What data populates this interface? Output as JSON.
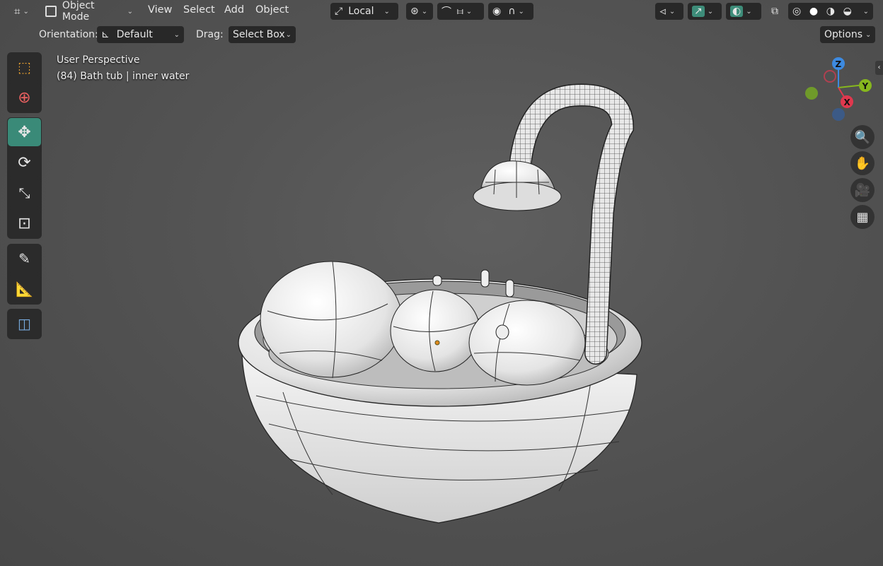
{
  "header": {
    "mode_label": "Object Mode",
    "menus": [
      "View",
      "Select",
      "Add",
      "Object"
    ],
    "transform_orientation": "Local",
    "editor_type_icon": "grid-editor-icon"
  },
  "tool_settings": {
    "orientation_label": "Orientation:",
    "orientation_value": "Default",
    "drag_label": "Drag:",
    "drag_value": "Select Box",
    "options_label": "Options"
  },
  "overlay": {
    "view_name": "User Perspective",
    "object_info": "(84) Bath tub | inner water"
  },
  "gizmo": {
    "x": "X",
    "y": "Y",
    "z": "Z"
  },
  "toolbar": [
    "select-box-icon",
    "cursor-icon",
    "move-icon",
    "rotate-icon",
    "scale-icon",
    "transform-icon",
    "annotate-icon",
    "measure-icon",
    "add-cube-icon"
  ],
  "colors": {
    "accent": "#3d8c79",
    "x_axis": "#e0384e",
    "y_axis": "#86b71e",
    "z_axis": "#3d8ae0"
  }
}
